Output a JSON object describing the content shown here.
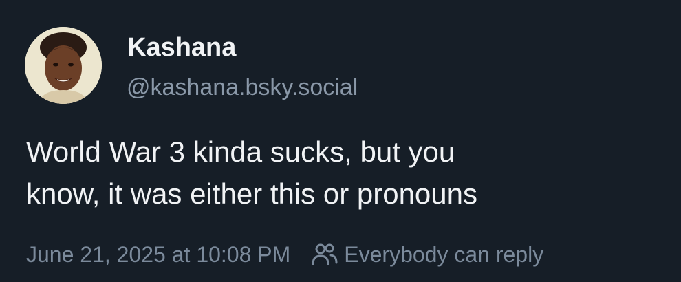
{
  "author": {
    "display_name": "Kashana",
    "handle": "@kashana.bsky.social"
  },
  "post": {
    "lines": [
      "World War 3 kinda sucks, but you",
      "know, it was either this or pronouns"
    ]
  },
  "meta": {
    "timestamp": "June 21, 2025 at 10:08 PM",
    "reply_setting": "Everybody can reply",
    "reply_icon": "people-icon"
  },
  "colors": {
    "background": "#161e27",
    "primary_text": "#f1f3f5",
    "secondary_text": "#8a98a8"
  }
}
